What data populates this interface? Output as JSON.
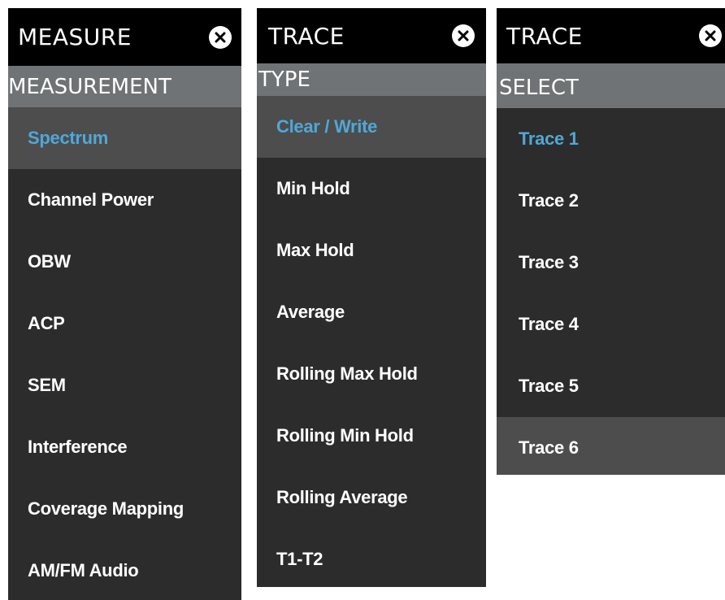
{
  "panels": [
    {
      "title": "MEASURE",
      "section": "MEASUREMENT",
      "items": [
        "Spectrum",
        "Channel Power",
        "OBW",
        "ACP",
        "SEM",
        "Interference",
        "Coverage Mapping",
        "AM/FM Audio"
      ]
    },
    {
      "title": "TRACE",
      "section": "TYPE",
      "items": [
        "Clear / Write",
        "Min Hold",
        "Max Hold",
        "Average",
        "Rolling Max Hold",
        "Rolling Min Hold",
        "Rolling Average",
        "T1-T2"
      ]
    },
    {
      "title": "TRACE",
      "section": "SELECT",
      "items": [
        "Trace 1",
        "Trace 2",
        "Trace 3",
        "Trace 4",
        "Trace 5",
        "Trace 6"
      ]
    }
  ],
  "colors": {
    "active_text": "#4ea8d8",
    "highlight_bg": "#4d4d4d",
    "panel_bg": "#2c2c2c",
    "section_bg": "#707375",
    "header_bg": "#000000"
  }
}
